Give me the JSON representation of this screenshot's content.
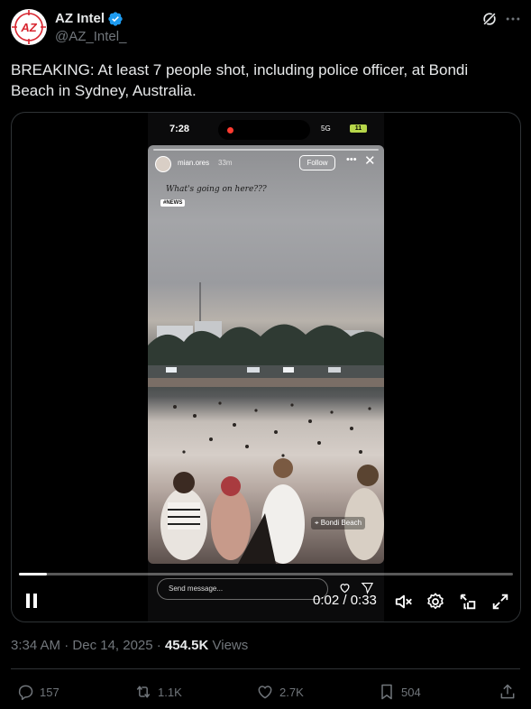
{
  "author": {
    "display_name": "AZ Intel",
    "handle": "@AZ_Intel_",
    "avatar_text": "AZ",
    "verified": true
  },
  "tweet": {
    "text": "BREAKING: At least 7 people shot, including police officer, at Bondi Beach in Sydney, Australia."
  },
  "media": {
    "phone_status": {
      "time": "7:28",
      "network": "5G",
      "battery": "11"
    },
    "story": {
      "username": "mian.ores",
      "posted_ago": "33m",
      "follow_label": "Follow",
      "caption": "What's going on here???",
      "tag": "#NEWS",
      "location": "Bondi Beach",
      "send_message_placeholder": "Send message..."
    },
    "player": {
      "current_time": "0:02",
      "duration": "0:33",
      "time_display": "0:02 / 0:33",
      "progress_fraction": 0.057,
      "state": "playing"
    }
  },
  "meta": {
    "time": "3:34 AM",
    "date": "Dec 14, 2025",
    "views_count": "454.5K",
    "views_label": "Views"
  },
  "actions": {
    "replies": "157",
    "reposts": "1.1K",
    "likes": "2.7K",
    "bookmarks": "504"
  },
  "colors": {
    "background": "#000000",
    "text_primary": "#e7e9ea",
    "text_secondary": "#71767b",
    "verified_blue": "#1d9bf0",
    "border": "#2f3336",
    "brand_red": "#d8252f"
  }
}
